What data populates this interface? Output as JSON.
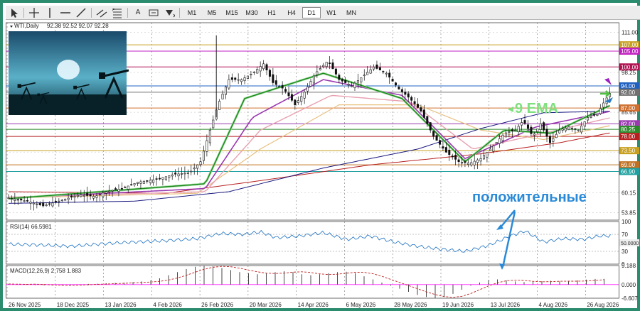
{
  "toolbar": {
    "tools": [
      "cursor-icon",
      "crosshair-icon",
      "vertical-line-icon",
      "horizontal-line-icon",
      "trendline-icon",
      "parallel-lines-icon",
      "fibonacci-icon",
      "text-icon",
      "label-icon",
      "arrow-tool-icon"
    ],
    "text_tool": "A",
    "timeframes": [
      "M1",
      "M5",
      "M15",
      "M30",
      "H1",
      "H4",
      "D1",
      "W1",
      "MN"
    ],
    "active_timeframe": "D1"
  },
  "colors": {
    "frame": "#2b8c6d",
    "candle": "#111111",
    "ema9": "#1a8a1a",
    "ema9_glow": "#9ed89e",
    "ema_purple": "#9a3ab0",
    "ema_pink": "#e8a0b0",
    "ema_orange": "#e8c080",
    "ma_navy": "#1a1a80",
    "ma_red": "#b82020",
    "rsi": "#1a6fc0",
    "macd_signal": "#c02020",
    "annotation_green": "#7ee07e",
    "annotation_blue": "#2a8ad8"
  },
  "header": {
    "symbol": "WTI,Daily",
    "ohlc": "92.38 92.52 92.07 92.28"
  },
  "annotations": {
    "ema_label": "9 EMA",
    "positive_label": "положительные"
  },
  "rsi_label": "RSI(14) 66.5981",
  "macd_label": "MACD(12,26,9) 2.758 1.883",
  "chart_data": {
    "type": "candlestick",
    "symbol": "WTI",
    "timeframe": "Daily",
    "x_tick_labels": [
      "26 Nov 2025",
      "18 Dec 2025",
      "13 Jan 2026",
      "4 Feb 2026",
      "26 Feb 2026",
      "20 Mar 2026",
      "14 Apr 2026",
      "6 May 2026",
      "28 May 2026",
      "19 Jun 2026",
      "13 Jul 2026",
      "4 Aug 2026",
      "26 Aug 2026"
    ],
    "price_ticks": [
      111.0,
      98.25,
      85.65,
      73.05,
      60.15,
      53.85
    ],
    "price_ylim": [
      51.5,
      114.0
    ],
    "grid": true,
    "levels": [
      {
        "price": 107.0,
        "label": "107.00",
        "color": "#c8a020"
      },
      {
        "price": 105.0,
        "label": "105.00",
        "color": "#c020c0"
      },
      {
        "price": 100.0,
        "label": "100.00",
        "color": "#b01050"
      },
      {
        "price": 94.0,
        "label": "94.00",
        "color": "#2060c0"
      },
      {
        "price": 92.0,
        "label": "92.00",
        "color": "#707070"
      },
      {
        "price": 87.0,
        "label": "87.00",
        "color": "#d07030"
      },
      {
        "price": 82.0,
        "label": "82.00",
        "color": "#9a3ab0"
      },
      {
        "price": 80.25,
        "label": "80.25",
        "color": "#2a8a2a"
      },
      {
        "price": 78.0,
        "label": "78.00",
        "color": "#b82020"
      },
      {
        "price": 73.5,
        "label": "73.50",
        "color": "#c8a020"
      },
      {
        "price": 69.0,
        "label": "69.00",
        "color": "#c07020"
      },
      {
        "price": 66.9,
        "label": "66.90",
        "color": "#20a0a0"
      }
    ],
    "close_path": [
      [
        0,
        58.5
      ],
      [
        12,
        57.5
      ],
      [
        22,
        56.0
      ],
      [
        35,
        58.0
      ],
      [
        45,
        59.5
      ],
      [
        55,
        59.0
      ],
      [
        62,
        60.5
      ],
      [
        72,
        61.5
      ],
      [
        82,
        63.5
      ],
      [
        95,
        64.5
      ],
      [
        105,
        66.0
      ],
      [
        115,
        66.5
      ],
      [
        122,
        70.0
      ],
      [
        128,
        80.0
      ],
      [
        133,
        88.0
      ],
      [
        140,
        96.0
      ],
      [
        148,
        96.0
      ],
      [
        155,
        98.0
      ],
      [
        162,
        101.0
      ],
      [
        168,
        95.0
      ],
      [
        175,
        93.0
      ],
      [
        182,
        88.0
      ],
      [
        188,
        92.0
      ],
      [
        195,
        98.0
      ],
      [
        203,
        102.0
      ],
      [
        210,
        96.0
      ],
      [
        218,
        94.0
      ],
      [
        225,
        97.0
      ],
      [
        232,
        100.0
      ],
      [
        240,
        98.0
      ],
      [
        248,
        93.0
      ],
      [
        255,
        90.0
      ],
      [
        262,
        86.0
      ],
      [
        270,
        78.0
      ],
      [
        278,
        73.0
      ],
      [
        286,
        70.0
      ],
      [
        293,
        69.5
      ],
      [
        300,
        71.0
      ],
      [
        308,
        75.0
      ],
      [
        315,
        79.0
      ],
      [
        322,
        80.0
      ],
      [
        327,
        83.0
      ],
      [
        333,
        78.0
      ],
      [
        338,
        82.0
      ],
      [
        344,
        76.0
      ],
      [
        350,
        80.0
      ],
      [
        356,
        81.0
      ],
      [
        362,
        80.0
      ],
      [
        368,
        84.0
      ],
      [
        374,
        85.0
      ],
      [
        379,
        89.5
      ],
      [
        383,
        92.3
      ]
    ],
    "ma_navy_path": [
      [
        0,
        56.8
      ],
      [
        80,
        57.5
      ],
      [
        140,
        60.5
      ],
      [
        200,
        68.0
      ],
      [
        260,
        74.0
      ],
      [
        300,
        80.5
      ],
      [
        340,
        85.5
      ],
      [
        383,
        86.0
      ]
    ],
    "ma_red_path": [
      [
        0,
        60.5
      ],
      [
        100,
        60.0
      ],
      [
        160,
        64.0
      ],
      [
        230,
        69.0
      ],
      [
        300,
        72.5
      ],
      [
        350,
        76.0
      ],
      [
        383,
        79.2
      ]
    ],
    "ema_orange_path": [
      [
        0,
        58.5
      ],
      [
        120,
        60.0
      ],
      [
        160,
        74.0
      ],
      [
        210,
        88.0
      ],
      [
        260,
        88.0
      ],
      [
        300,
        80.0
      ],
      [
        340,
        77.0
      ],
      [
        383,
        81.5
      ]
    ],
    "ema_pink_path": [
      [
        0,
        58.8
      ],
      [
        125,
        60.5
      ],
      [
        160,
        80.0
      ],
      [
        205,
        91.0
      ],
      [
        255,
        89.0
      ],
      [
        295,
        74.0
      ],
      [
        340,
        79.0
      ],
      [
        383,
        84.0
      ]
    ],
    "ema_purple_path": [
      [
        0,
        58.5
      ],
      [
        125,
        61.5
      ],
      [
        155,
        84.0
      ],
      [
        200,
        96.0
      ],
      [
        250,
        91.0
      ],
      [
        290,
        71.0
      ],
      [
        335,
        81.0
      ],
      [
        383,
        86.0
      ]
    ],
    "ema9_path": [
      [
        0,
        58.3
      ],
      [
        125,
        63.0
      ],
      [
        150,
        90.0
      ],
      [
        200,
        98.0
      ],
      [
        250,
        90.0
      ],
      [
        290,
        70.0
      ],
      [
        315,
        80.0
      ],
      [
        345,
        79.0
      ],
      [
        383,
        88.0
      ]
    ],
    "rsi": {
      "last": 66.5981,
      "ticks": [
        100,
        70,
        50,
        30,
        0
      ],
      "path": [
        [
          0,
          47
        ],
        [
          20,
          45
        ],
        [
          40,
          42
        ],
        [
          60,
          48
        ],
        [
          80,
          52
        ],
        [
          100,
          55
        ],
        [
          120,
          60
        ],
        [
          135,
          72
        ],
        [
          150,
          70
        ],
        [
          160,
          76
        ],
        [
          170,
          62
        ],
        [
          185,
          66
        ],
        [
          200,
          74
        ],
        [
          215,
          58
        ],
        [
          230,
          66
        ],
        [
          245,
          52
        ],
        [
          260,
          42
        ],
        [
          275,
          35
        ],
        [
          290,
          30
        ],
        [
          305,
          44
        ],
        [
          318,
          65
        ],
        [
          328,
          78
        ],
        [
          340,
          52
        ],
        [
          352,
          60
        ],
        [
          365,
          58
        ],
        [
          375,
          66
        ],
        [
          383,
          66.6
        ]
      ]
    },
    "macd": {
      "main": 2.758,
      "signal": 1.883,
      "ticks": [
        9.188,
        0.0,
        -6.607
      ],
      "histogram": [
        0.3,
        0.2,
        0.1,
        -0.2,
        -0.4,
        -0.5,
        -0.3,
        -0.1,
        0.1,
        0.3,
        0.4,
        0.6,
        0.8,
        1.0,
        1.2,
        1.5,
        2.0,
        3.0,
        4.5,
        6.0,
        7.5,
        8.6,
        9.0,
        8.8,
        8.0,
        7.0,
        6.0,
        5.5,
        5.0,
        5.5,
        6.0,
        6.5,
        6.0,
        5.0,
        4.5,
        5.0,
        5.5,
        6.0,
        6.2,
        5.5,
        4.0,
        2.5,
        1.0,
        -0.5,
        -2.0,
        -3.5,
        -5.0,
        -6.0,
        -6.5,
        -6.0,
        -4.5,
        -2.5,
        -0.5,
        1.0,
        2.0,
        2.5,
        2.0,
        1.5,
        1.2,
        1.4,
        1.6,
        1.8,
        1.5,
        1.6,
        2.0,
        2.4,
        2.7,
        2.76
      ]
    }
  }
}
